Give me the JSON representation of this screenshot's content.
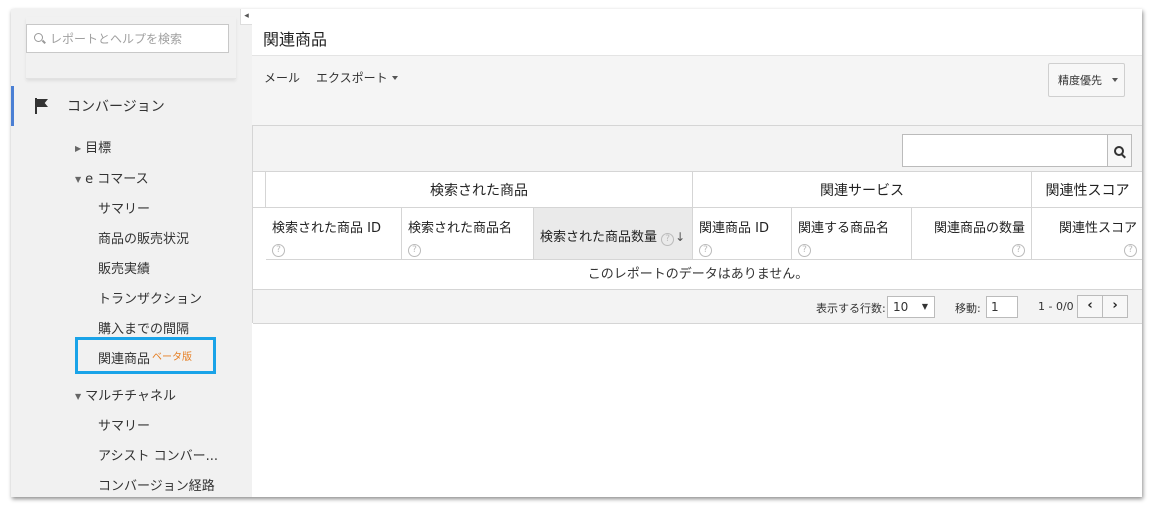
{
  "sidebar": {
    "search_placeholder": "レポートとヘルプを検索",
    "collapse_glyph": "◂",
    "section_label": "コンバージョン",
    "items": {
      "goals": "目標",
      "ecommerce": "e コマース",
      "summary": "サマリー",
      "product_performance": "商品の販売状況",
      "sales_performance": "販売実績",
      "transactions": "トランザクション",
      "time_to_purchase": "購入までの間隔",
      "related_products": "関連商品",
      "beta": "ベータ版",
      "multichannel": "マルチチャネル",
      "mc_summary": "サマリー",
      "assisted_conversions": "アシスト コンバー...",
      "conversion_paths": "コンバージョン経路"
    }
  },
  "main": {
    "title": "関連商品",
    "toolbar": {
      "email": "メール",
      "export": "エクスポート",
      "precision": "精度優先"
    },
    "table": {
      "groups": {
        "searched": "検索された商品",
        "related": "関連サービス",
        "score": "関連性スコア"
      },
      "columns": {
        "searched_id": "検索された商品 ID",
        "searched_name": "検索された商品名",
        "searched_qty": "検索された商品数量",
        "related_id": "関連商品 ID",
        "related_name": "関連する商品名",
        "related_qty": "関連商品の数量",
        "score": "関連性スコア"
      },
      "help_glyph": "?",
      "sort_glyph": "↓",
      "empty_message": "このレポートのデータはありません。"
    },
    "pager": {
      "rows_label": "表示する行数:",
      "rows_value": "10",
      "goto_label": "移動:",
      "goto_value": "1",
      "range": "1 - 0/0",
      "prev": "‹",
      "next": "›"
    }
  }
}
